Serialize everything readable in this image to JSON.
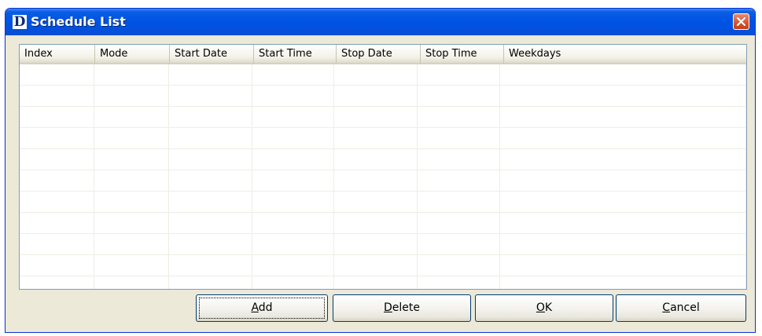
{
  "window": {
    "title": "Schedule List",
    "logo_letter": "D",
    "close_icon": "close-x-icon"
  },
  "list": {
    "columns": [
      "Index",
      "Mode",
      "Start Date",
      "Start Time",
      "Stop Date",
      "Stop Time",
      "Weekdays"
    ],
    "rows": []
  },
  "buttons": {
    "add": {
      "mnemonic": "A",
      "rest": "dd"
    },
    "delete": {
      "mnemonic": "D",
      "rest": "elete"
    },
    "ok": {
      "mnemonic": "O",
      "rest": "K"
    },
    "cancel": {
      "mnemonic": "C",
      "rest": "ancel"
    }
  },
  "colors": {
    "titlebar": "#0054e3",
    "dialog_bg": "#ece9d8",
    "close_button": "#d2542f"
  }
}
